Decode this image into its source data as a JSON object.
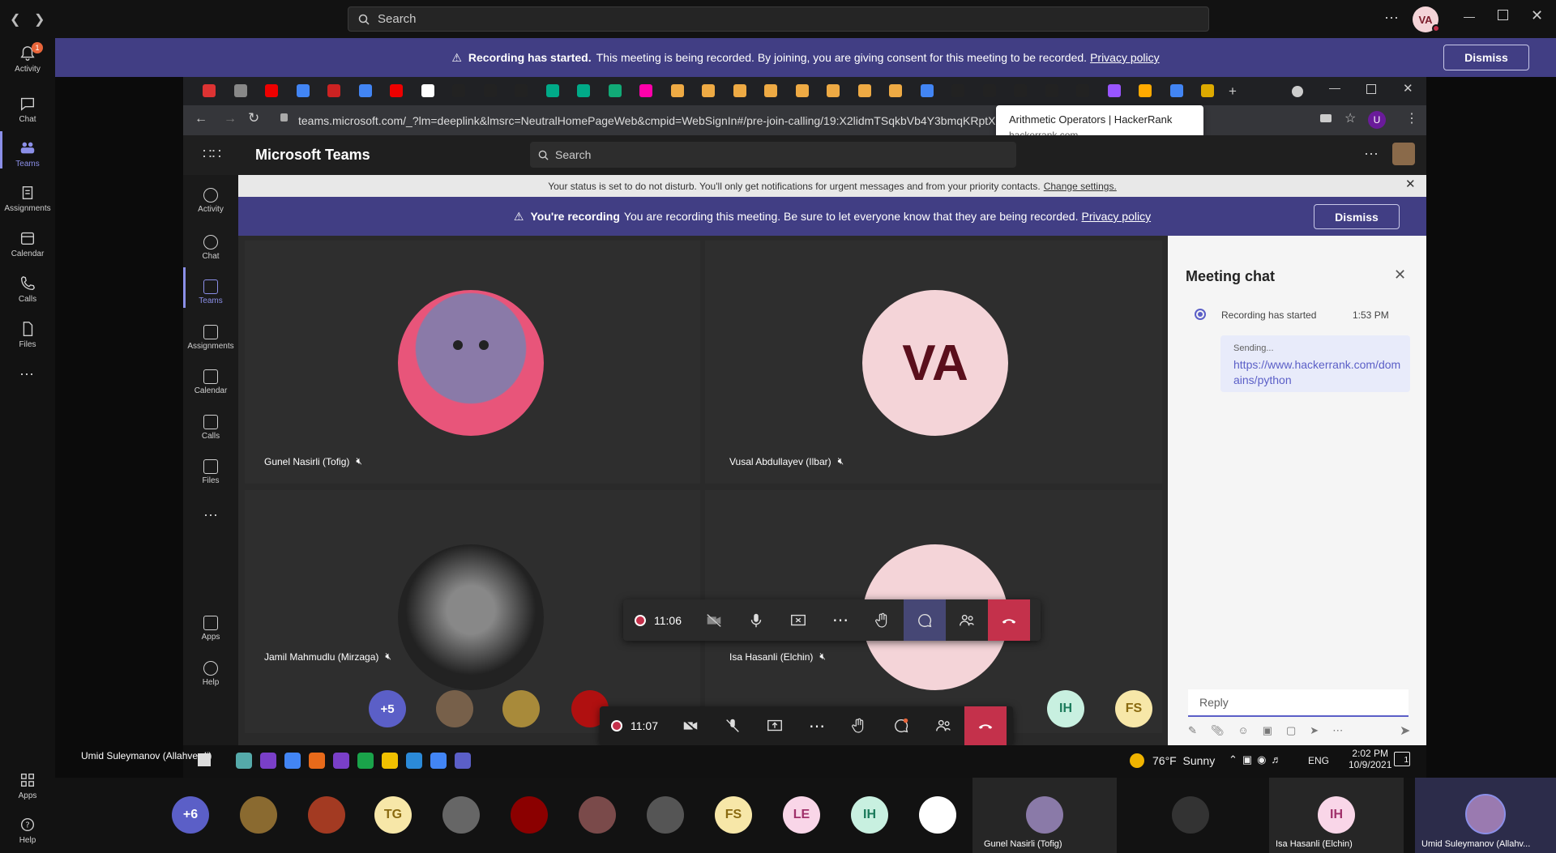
{
  "outer_search": {
    "placeholder": "Search"
  },
  "user_initials": "VA",
  "outer_rail": [
    {
      "label": "Activity",
      "icon": "bell-icon",
      "badge": "1"
    },
    {
      "label": "Chat",
      "icon": "chat-icon"
    },
    {
      "label": "Teams",
      "icon": "teams-icon"
    },
    {
      "label": "Assignments",
      "icon": "assignments-icon"
    },
    {
      "label": "Calendar",
      "icon": "calendar-icon"
    },
    {
      "label": "Calls",
      "icon": "phone-icon"
    },
    {
      "label": "Files",
      "icon": "file-icon"
    },
    {
      "label": "Apps",
      "icon": "apps-icon"
    },
    {
      "label": "Help",
      "icon": "help-icon"
    }
  ],
  "rec_banner": {
    "title": "Recording has started.",
    "text": "This meeting is being recorded. By joining, you are giving consent for this meeting to be recorded.",
    "link": "Privacy policy",
    "dismiss": "Dismiss"
  },
  "browser": {
    "url": "teams.microsoft.com/_?lm=deeplink&lmsrc=NeutralHomePageWeb&cmpid=WebSignIn#/pre-join-calling/19:X2lidmTSqkbVb4Y3bmqKRptX",
    "tooltip_title": "Arithmetic Operators | HackerRank",
    "tooltip_domain": "hackerrank.com",
    "profile_initial": "U"
  },
  "inner_app": {
    "title": "Microsoft Teams",
    "search_placeholder": "Search",
    "rail": [
      "Activity",
      "Chat",
      "Teams",
      "Assignments",
      "Calendar",
      "Calls",
      "Files",
      "Apps",
      "Help"
    ],
    "status_text": "Your status is set to do not disturb. You'll only get notifications for urgent messages and from your priority contacts.",
    "status_link": "Change settings.",
    "rec_title": "You're recording",
    "rec_text": "You are recording this meeting. Be sure to let everyone know that they are being recorded.",
    "rec_link": "Privacy policy",
    "rec_dismiss": "Dismiss"
  },
  "tiles": [
    {
      "name": "Gunel Nasirli (Tofig)"
    },
    {
      "name": "Vusal Abdullayev (Ilbar)",
      "initials": "VA"
    },
    {
      "name": "Jamil Mahmudlu (Mirzaga)"
    },
    {
      "name": "Isa Hasanli (Elchin)"
    }
  ],
  "controls": {
    "timer_inner": "11:06",
    "timer_outer": "11:07"
  },
  "overflow_strip": {
    "more": "+5",
    "ih": "IH",
    "fs": "FS"
  },
  "chat": {
    "title": "Meeting chat",
    "event": "Recording has started",
    "event_time": "1:53 PM",
    "sending": "Sending...",
    "message_link": "https://www.hackerrank.com/domains/python",
    "reply_placeholder": "Reply"
  },
  "taskbar": {
    "presenter": "Umid Suleymanov (Allahverdi)",
    "weather": "76°F  Sunny",
    "lang": "ENG",
    "time": "2:02 PM",
    "date": "10/9/2021",
    "notif": "1"
  },
  "strip": {
    "more": "+6",
    "initials": [
      "TG",
      "FS",
      "LE",
      "IH"
    ],
    "named": [
      {
        "name": "Gunel Nasirli (Tofig)"
      },
      {
        "name": "Isa Hasanli (Elchin)",
        "initials": "IH"
      },
      {
        "name": "Umid Suleymanov (Allahv..."
      }
    ]
  },
  "colors": {
    "accent": "#8b8fe8",
    "banner": "#413e84",
    "hangup": "#c4314b",
    "va_bg": "#f4d4d8",
    "va_fg": "#7a1c2a"
  }
}
